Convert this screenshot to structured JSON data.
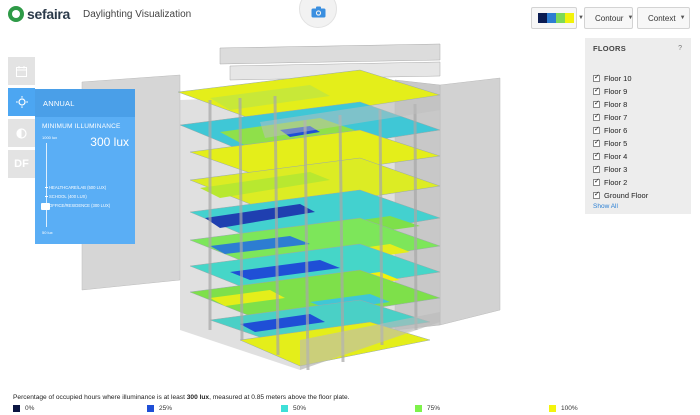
{
  "app": {
    "brand": "sefaira",
    "title": "Daylighting Visualization"
  },
  "toolbar": {
    "colors": [
      "#0b1c52",
      "#2d7dd2",
      "#7ed957",
      "#f2f20a"
    ],
    "contour_label": "Contour",
    "context_label": "Context"
  },
  "rail": {
    "items": [
      {
        "name": "calendar-icon"
      },
      {
        "name": "sun-icon"
      },
      {
        "name": "half-circle-icon"
      },
      {
        "name": "df",
        "label": "DF"
      }
    ]
  },
  "panel": {
    "heading": "ANNUAL",
    "min_illuminance_label": "MINIMUM ILLUMINANCE",
    "value": "300 lux",
    "scale_top": "1000 lux",
    "scale_bottom": "50 lux",
    "marks": [
      "HEALTHCARE/LAB (500 LUX)",
      "SCHOOL (400 LUX)",
      "OFFICE/RESIDENCE (300 LUX)"
    ]
  },
  "floors": {
    "title": "FLOORS",
    "help": "?",
    "items": [
      "Floor 10",
      "Floor 9",
      "Floor 8",
      "Floor 7",
      "Floor 6",
      "Floor 5",
      "Floor 4",
      "Floor 3",
      "Floor 2",
      "Ground Floor"
    ],
    "show_all": "Show All"
  },
  "caption": {
    "prefix": "Percentage of occupied hours where illuminance is at least ",
    "value": "300 lux",
    "suffix": ", measured at 0.85 meters above the floor plate."
  },
  "legend": [
    {
      "label": "0%",
      "color": "#0b1542"
    },
    {
      "label": "25%",
      "color": "#1f4fd6"
    },
    {
      "label": "50%",
      "color": "#3fe0d8"
    },
    {
      "label": "75%",
      "color": "#7ef24a"
    },
    {
      "label": "100%",
      "color": "#f4f40c"
    }
  ]
}
